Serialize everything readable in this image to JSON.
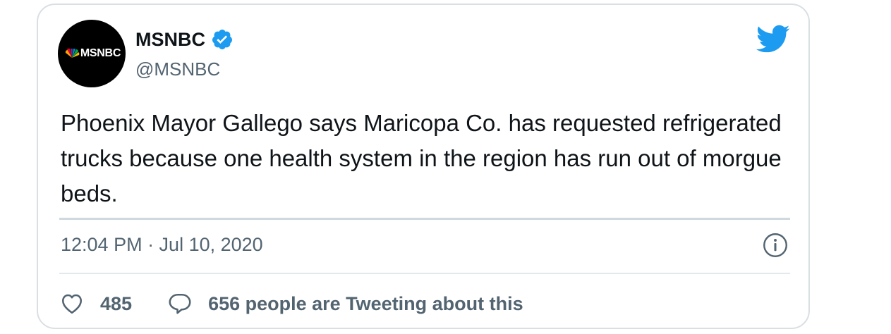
{
  "tweet": {
    "avatar_text": "MSNBC",
    "display_name": "MSNBC",
    "handle": "@MSNBC",
    "text": "Phoenix Mayor Gallego says Maricopa Co. has requested refrigerated trucks because one health system in the region has run out of morgue beds.",
    "timestamp": "12:04 PM · Jul 10, 2020",
    "likes": "485",
    "conversation": "656 people are Tweeting about this"
  },
  "icons": {
    "brand": "twitter-bird-icon",
    "verified": "verified-badge-icon",
    "info": "info-icon",
    "like": "heart-icon",
    "reply": "speech-bubble-icon",
    "avatar_logo": "nbc-peacock-icon"
  },
  "colors": {
    "twitter_blue": "#1d9bf0",
    "text_primary": "#0f1419",
    "text_secondary": "#536471",
    "border": "#d9dfe3"
  }
}
